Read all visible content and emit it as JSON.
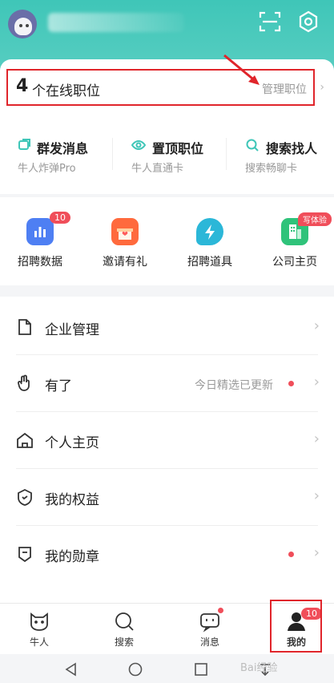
{
  "colors": {
    "accent": "#3fc6b8",
    "badge": "#f04e5a",
    "highlight": "#e0252b"
  },
  "header": {
    "scan_icon": "scan-icon",
    "settings_icon": "settings-icon"
  },
  "positions": {
    "count": "4",
    "label": "个在线职位",
    "manage_label": "管理职位"
  },
  "features": [
    {
      "title": "群发消息",
      "sub": "牛人炸弹Pro",
      "icon": "message-icon"
    },
    {
      "title": "置顶职位",
      "sub": "牛人直通卡",
      "icon": "eye-icon"
    },
    {
      "title": "搜索找人",
      "sub": "搜索畅聊卡",
      "icon": "search-icon"
    }
  ],
  "tools": [
    {
      "label": "招聘数据",
      "badge": "10",
      "icon": "chart-icon"
    },
    {
      "label": "邀请有礼",
      "badge": "",
      "icon": "gift-icon"
    },
    {
      "label": "招聘道具",
      "badge": "",
      "icon": "lightning-icon"
    },
    {
      "label": "公司主页",
      "badge": "写体验",
      "icon": "building-icon"
    }
  ],
  "menu": [
    {
      "label": "企业管理",
      "status": "",
      "dot": false,
      "icon": "file-icon"
    },
    {
      "label": "有了",
      "status": "今日精选已更新",
      "dot": true,
      "icon": "hand-icon"
    },
    {
      "label": "个人主页",
      "status": "",
      "dot": false,
      "icon": "home-icon"
    },
    {
      "label": "我的权益",
      "status": "",
      "dot": false,
      "icon": "shield-icon"
    },
    {
      "label": "我的勋章",
      "status": "",
      "dot": true,
      "icon": "medal-icon"
    }
  ],
  "tabbar": [
    {
      "label": "牛人",
      "icon": "cat-icon",
      "badge": ""
    },
    {
      "label": "搜索",
      "icon": "search-icon",
      "badge": ""
    },
    {
      "label": "消息",
      "icon": "chat-icon",
      "badge": "dot"
    },
    {
      "label": "我的",
      "icon": "profile-icon",
      "badge": "10"
    }
  ],
  "watermark": "Bai经验"
}
